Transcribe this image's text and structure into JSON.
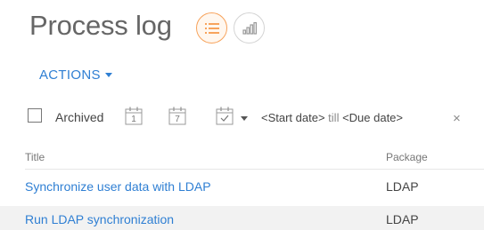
{
  "page": {
    "title": "Process log"
  },
  "view_toggle": {
    "list_icon": "list-icon",
    "chart_icon": "bar-chart-icon"
  },
  "actions": {
    "label": "ACTIONS"
  },
  "filters": {
    "archived_label": "Archived",
    "day_icon_number": "1",
    "week_icon_number": "7",
    "period_start": "<Start date>",
    "period_sep": " till ",
    "period_end": "<Due date>",
    "clear_symbol": "×"
  },
  "table": {
    "columns": [
      "Title",
      "Package"
    ],
    "rows": [
      {
        "title": "Synchronize user data with LDAP",
        "package": "LDAP"
      },
      {
        "title": "Run LDAP synchronization",
        "package": "LDAP"
      }
    ]
  },
  "colors": {
    "accent": "#2f7fd3",
    "active_view": "#f7a35c"
  }
}
